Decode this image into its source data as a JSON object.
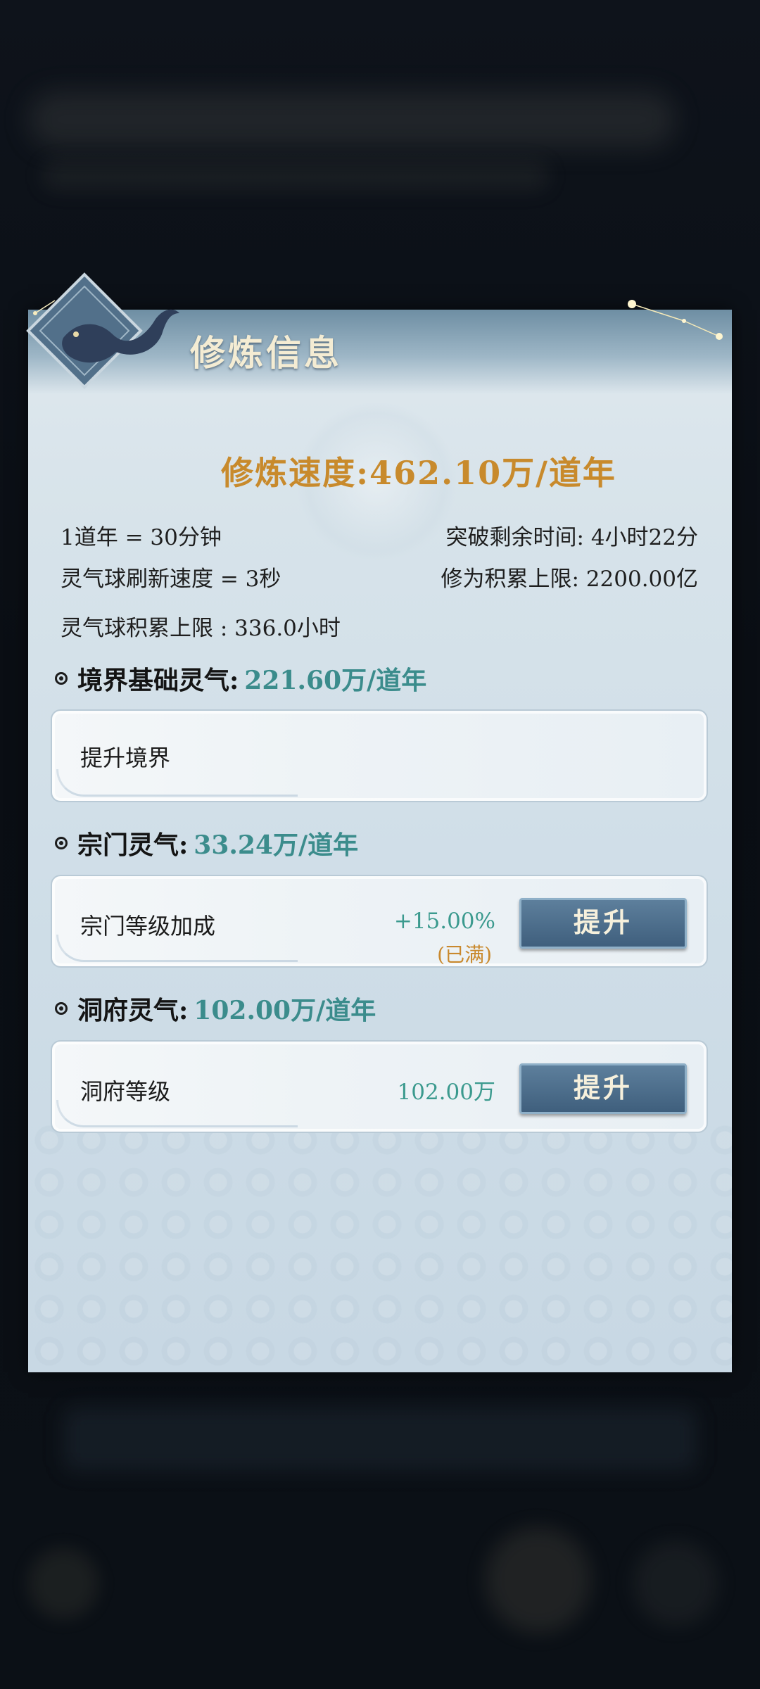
{
  "panel": {
    "title": "修炼信息",
    "speed": "修炼速度:462.10万/道年"
  },
  "info": {
    "dao_year": "1道年 = 30分钟",
    "breakthrough_time": "突破剩余时间: 4小时22分",
    "orb_refresh": "灵气球刷新速度 = 3秒",
    "cultivation_cap": "修为积累上限: 2200.00亿",
    "orb_cap": "灵气球积累上限 : 336.0小时"
  },
  "sections": [
    {
      "title": "境界基础灵气:",
      "value": "221.60万/道年",
      "row": {
        "label": "提升境界"
      }
    },
    {
      "title": "宗门灵气:",
      "value": "33.24万/道年",
      "row": {
        "label": "宗门等级加成",
        "value": "+15.00%",
        "sub": "(已满)",
        "button": "提升"
      }
    },
    {
      "title": "洞府灵气:",
      "value": "102.00万/道年",
      "row": {
        "label": "洞府等级",
        "value": "102.00万",
        "button": "提升"
      }
    }
  ],
  "colors": {
    "accent_orange": "#c88a2c",
    "accent_teal": "#3b8c8c",
    "button_blue": "#3f5f7d"
  }
}
